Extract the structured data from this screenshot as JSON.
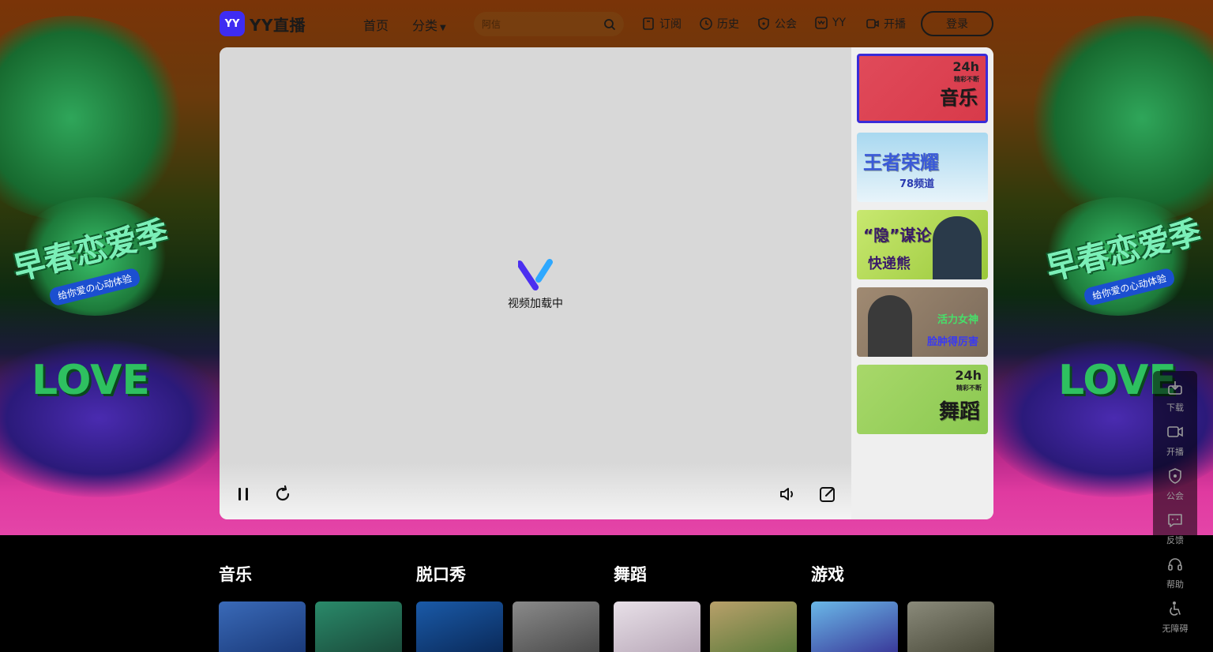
{
  "header": {
    "logo_mark": "YY",
    "logo_text": "YY直播",
    "nav": {
      "home": "首页",
      "category": "分类"
    },
    "search_placeholder": "阿信",
    "links": {
      "subscribe": "订阅",
      "history": "历史",
      "guild": "公会",
      "yy": "YY",
      "broadcast": "开播"
    },
    "login": "登录"
  },
  "hero": {
    "theme_title": "早春恋爱季",
    "theme_sub": "给你爱の心动体验",
    "love_text": "LOVE"
  },
  "player": {
    "loading_text": "视频加载中",
    "channels": [
      {
        "label": "音乐",
        "badge": "24h",
        "badge_sub": "精彩不断",
        "active": true
      },
      {
        "label": "王者荣耀",
        "sub": "78频道"
      },
      {
        "label": "“隐”谋论",
        "sub": "快递熊"
      },
      {
        "label": "活力女神",
        "sub": "脸肿得厉害"
      },
      {
        "label": "舞蹈",
        "badge": "24h",
        "badge_sub": "精彩不断"
      }
    ]
  },
  "float_panel": {
    "download": "下载",
    "broadcast": "开播",
    "guild": "公会",
    "feedback": "反馈",
    "help": "帮助",
    "accessibility": "无障碍"
  },
  "categories": [
    {
      "title": "音乐"
    },
    {
      "title": "脱口秀"
    },
    {
      "title": "舞蹈"
    },
    {
      "title": "游戏"
    }
  ],
  "colors": {
    "brand": "#3e2cf2",
    "active_border": "#3a2bd8",
    "hero_pink": "#e445a8"
  }
}
